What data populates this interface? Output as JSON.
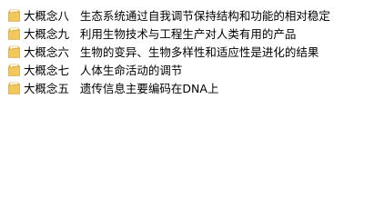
{
  "explorer": {
    "items": [
      {
        "name": "大概念八   生态系统通过自我调节保持结构和功能的相对稳定",
        "icon": "folder-icon"
      },
      {
        "name": "大概念九   利用生物技术与工程生产对人类有用的产品",
        "icon": "folder-icon"
      },
      {
        "name": "大概念六   生物的变异、生物多样性和适应性是进化的结果",
        "icon": "folder-icon"
      },
      {
        "name": "大概念七   人体生命活动的调节",
        "icon": "folder-icon"
      },
      {
        "name": "大概念五   遗传信息主要编码在DNA上",
        "icon": "folder-icon"
      }
    ]
  },
  "colors": {
    "folder_front": "#f2c75c",
    "folder_back": "#d9a632",
    "folder_paper": "#fff8e6",
    "text": "#000000",
    "background": "#ffffff"
  }
}
